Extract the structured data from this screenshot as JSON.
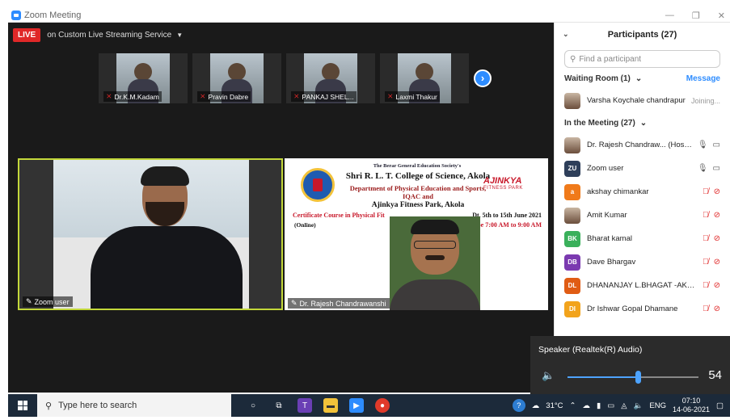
{
  "window": {
    "title": "Zoom Meeting",
    "controls": [
      "—",
      "❐",
      "✕"
    ]
  },
  "live": {
    "badge": "LIVE",
    "service": "on Custom Live Streaming Service"
  },
  "thumbnails": [
    {
      "name": "Dr.K.M.Kadam"
    },
    {
      "name": "Pravin Dabre"
    },
    {
      "name": "PANKAJ SHEL..."
    },
    {
      "name": "Laxmi Thakur"
    }
  ],
  "tiles": {
    "left": {
      "name": "Zoom user"
    },
    "right": {
      "name": "Dr. Rajesh Chandrawanshi"
    }
  },
  "poster": {
    "society": "The Berar General Education Society's",
    "college": "Shri R. L. T. College of Science, Akola",
    "dept": "Department of Physical Education and Sports, IQAC and",
    "fitness": "Ajinkya Fitness Park, Akola",
    "course": "Certificate Course in Physical Fit",
    "online": "(Online)",
    "date": "Dt. 5th to 15th June 2021",
    "youtube": "YouTube 7:00 AM to 9:00 AM",
    "logo_name": "AJINKYA",
    "logo_sub": "FITNESS PARK"
  },
  "panel": {
    "title": "Participants (27)",
    "search_placeholder": "Find a participant",
    "waiting_label": "Waiting Room (1)",
    "message_label": "Message",
    "waiting": [
      {
        "name": "Varsha Koychale chandrapur",
        "status": "Joining..."
      }
    ],
    "in_meeting_label": "In the Meeting (27)",
    "participants": [
      {
        "initials": "",
        "name": "Dr. Rajesh Chandraw... (Host, me)",
        "color": "photo",
        "muted": false
      },
      {
        "initials": "ZU",
        "name": "Zoom user",
        "color": "#2e3f5a",
        "muted": false
      },
      {
        "initials": "a",
        "name": "akshay chimankar",
        "color": "#f07a1a",
        "muted": true
      },
      {
        "initials": "",
        "name": "Amit Kumar",
        "color": "photo",
        "muted": true
      },
      {
        "initials": "BK",
        "name": "Bharat kamal",
        "color": "#3ab05b",
        "muted": true
      },
      {
        "initials": "DB",
        "name": "Dave Bhargav",
        "color": "#7b3ab0",
        "muted": true
      },
      {
        "initials": "DL",
        "name": "DHANANJAY L.BHAGAT -AKOL...",
        "color": "#e05c14",
        "muted": true
      },
      {
        "initials": "DI",
        "name": "Dr Ishwar Gopal Dhamane",
        "color": "#f2a31c",
        "muted": true
      }
    ]
  },
  "speaker": {
    "label": "Speaker (Realtek(R) Audio)",
    "volume": "54",
    "volume_value": 54
  },
  "taskbar": {
    "search_placeholder": "Type here to search",
    "weather": "31°C",
    "lang": "ENG",
    "time": "07:10",
    "date": "14-06-2021"
  }
}
